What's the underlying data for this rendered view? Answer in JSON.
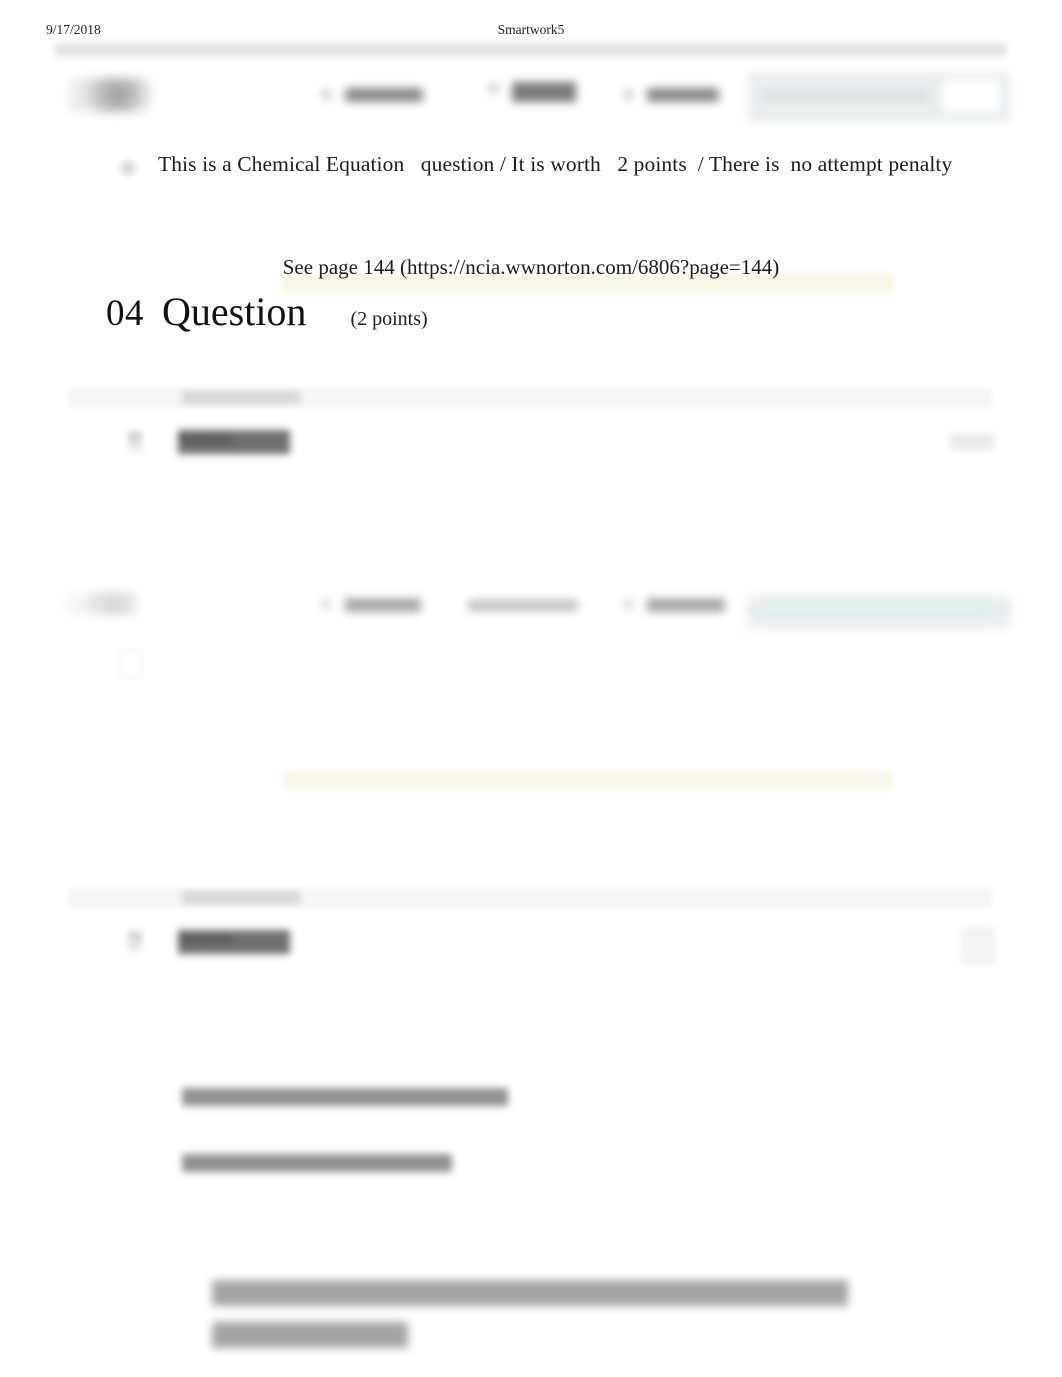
{
  "print_header": {
    "date": "9/17/2018",
    "document_title": "Smartwork5"
  },
  "question_meta": {
    "line": "This is a Chemical Equation   question / It is worth   2 points  / There is  no attempt penalty",
    "type": "Chemical Equation",
    "points_value": "2 points",
    "penalty": "no attempt penalty"
  },
  "page_reference": {
    "text": "See page 144 (https://ncia.wwnorton.com/6806?page=144)",
    "page_number": "144",
    "url": "https://ncia.wwnorton.com/6806?page=144"
  },
  "question_heading": {
    "number": "04",
    "label": "Question",
    "points": "(2 points)"
  },
  "sections": [
    {
      "band_label": "",
      "title": "Solution",
      "action": ""
    },
    {
      "band_label": "",
      "title": "Solution",
      "action": ""
    }
  ],
  "toolbar": {
    "items": [
      "",
      "",
      ""
    ],
    "search_placeholder": "",
    "search_button": ""
  },
  "colors": {
    "page_background": "#ffffff",
    "nav_band": "#d9dcdc",
    "search_panel": "#e9eeef",
    "highlight": "#f7f4e2",
    "section_band": "#f4f5f6",
    "text": "#1b1b1b"
  }
}
